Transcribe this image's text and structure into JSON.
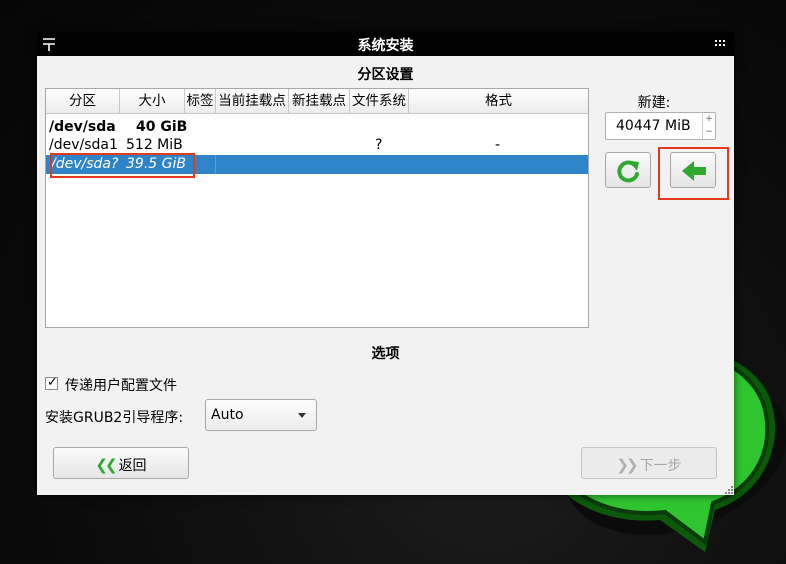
{
  "window": {
    "title": "系统安装"
  },
  "partitions": {
    "heading": "分区设置",
    "columns": [
      "分区",
      "大小",
      "标签",
      "当前挂载点",
      "新挂载点",
      "文件系统",
      "格式"
    ],
    "rows": [
      {
        "partition": "/dev/sda",
        "size": "40 GiB",
        "label": "",
        "current_mount": "",
        "new_mount": "",
        "filesystem": "",
        "format": ""
      },
      {
        "partition": "/dev/sda1",
        "size": "512 MiB",
        "label": "",
        "current_mount": "",
        "new_mount": "",
        "filesystem": "?",
        "format": "-"
      },
      {
        "partition": "/dev/sda?",
        "size": "39.5 GiB",
        "label": "",
        "current_mount": "",
        "new_mount": "",
        "filesystem": "",
        "format": ""
      }
    ]
  },
  "new_partition": {
    "label": "新建:",
    "size_value": "40447 MiB",
    "stepper_up": "+",
    "stepper_down": "−",
    "reset_icon": "refresh-icon",
    "add_icon": "arrow-left-icon"
  },
  "options": {
    "heading": "选项",
    "copy_user_config_label": "传递用户配置文件",
    "copy_user_config_checked": true,
    "check_mark": "✓",
    "grub_label": "安装GRUB2引导程序:",
    "grub_value": "Auto"
  },
  "footer": {
    "back_label": "返回",
    "back_chevrons": "❮❮",
    "next_label": "下一步",
    "next_chevrons": "❯❯",
    "next_enabled": false
  },
  "colors": {
    "selection": "#2f84c7",
    "highlight_box": "#e23a1c",
    "accent_green": "#2ea82e"
  }
}
